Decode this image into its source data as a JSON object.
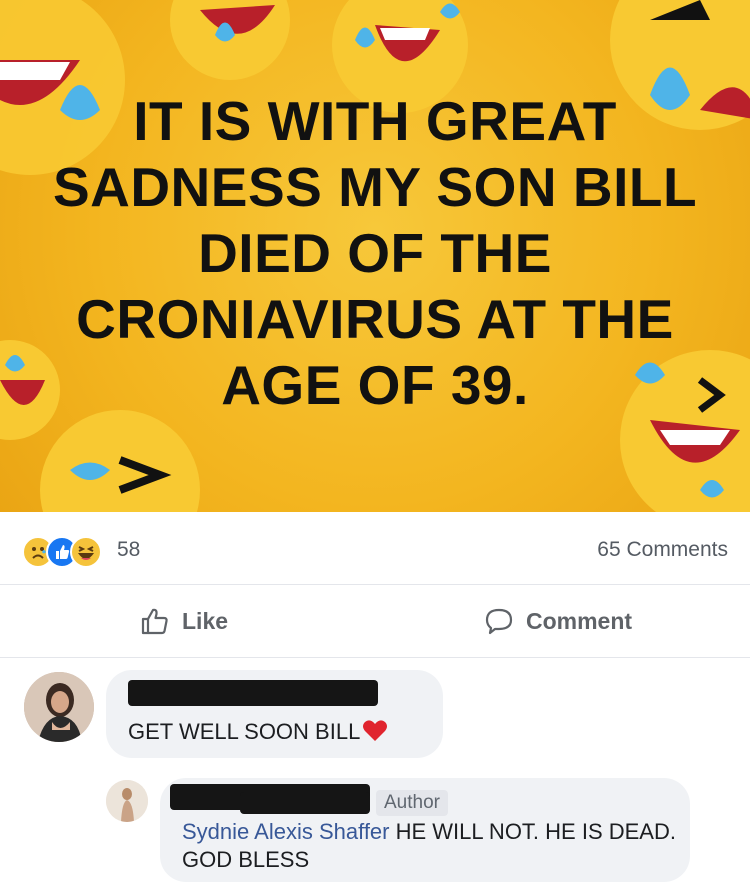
{
  "post": {
    "headline_lines": [
      "IT IS WITH GREAT",
      "SADNESS MY SON BILL",
      "DIED OF THE",
      "CRONIAVIRUS AT THE",
      "AGE OF 39."
    ]
  },
  "stats": {
    "reactions": [
      "sad-reaction-icon",
      "like-reaction-icon",
      "haha-reaction-icon"
    ],
    "reaction_count": "58",
    "comments_count": "65 Comments"
  },
  "actions": {
    "like_label": "Like",
    "comment_label": "Comment"
  },
  "comments": [
    {
      "text": "GET WELL SOON BILL"
    },
    {
      "badge": "Author",
      "mention": "Sydnie Alexis Shaffer",
      "text": " HE WILL NOT. HE IS DEAD. GOD BLESS"
    }
  ],
  "colors": {
    "background_yellow": "#f3b51f",
    "like_blue": "#1877f2",
    "mention_blue": "#385898",
    "bubble_gray": "#f0f2f5"
  }
}
